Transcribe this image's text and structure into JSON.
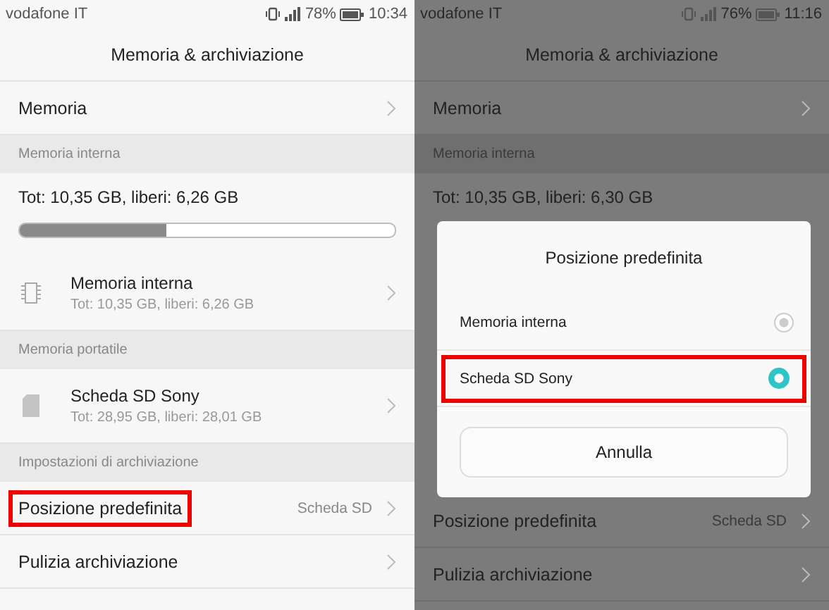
{
  "screens": [
    {
      "dimmed": false,
      "status_bar": {
        "carrier": "vodafone IT",
        "battery": "78%",
        "time": "10:34"
      },
      "title": "Memoria & archiviazione",
      "items": [
        {
          "kind": "link",
          "label": "Memoria",
          "highlighted": false
        },
        {
          "kind": "header",
          "label": "Memoria interna"
        },
        {
          "kind": "summary",
          "label": "Tot: 10,35 GB, liberi: 6,26 GB",
          "level": 0.39
        },
        {
          "kind": "internal",
          "label": "Memoria interna",
          "detail": "Tot: 10,35 GB, liberi: 6,26 GB"
        },
        {
          "kind": "header",
          "label": "Memoria portatile"
        },
        {
          "kind": "removable",
          "label": "Scheda SD Sony",
          "detail": "Tot: 28,95 GB, liberi: 28,01 GB"
        },
        {
          "kind": "header",
          "label": "Impostazioni di archiviazione"
        },
        {
          "kind": "link",
          "label": "Posizione predefinita",
          "value": "Scheda SD",
          "highlighted": true
        },
        {
          "kind": "link",
          "label": "Pulizia archiviazione",
          "highlighted": false
        }
      ]
    },
    {
      "dimmed": true,
      "status_bar": {
        "carrier": "vodafone IT",
        "battery": "76%",
        "time": "11:16"
      },
      "title": "Memoria & archiviazione",
      "items": [
        {
          "kind": "link",
          "label": "Memoria",
          "highlighted": false
        },
        {
          "kind": "header",
          "label": "Memoria interna"
        },
        {
          "kind": "summary",
          "label": "Tot: 10,35 GB, liberi: 6,30 GB"
        },
        {
          "kind": "dialog",
          "title": "Posizione predefinita",
          "cancel": "Annulla",
          "options": [
            {
              "label": "Memoria interna",
              "selected": false,
              "highlighted": false
            },
            {
              "label": "Scheda SD Sony",
              "selected": true,
              "highlighted": true
            }
          ]
        },
        {
          "kind": "link",
          "label": "Posizione predefinita",
          "value": "Scheda SD",
          "highlighted": false
        },
        {
          "kind": "link",
          "label": "Pulizia archiviazione",
          "highlighted": false
        }
      ]
    }
  ]
}
